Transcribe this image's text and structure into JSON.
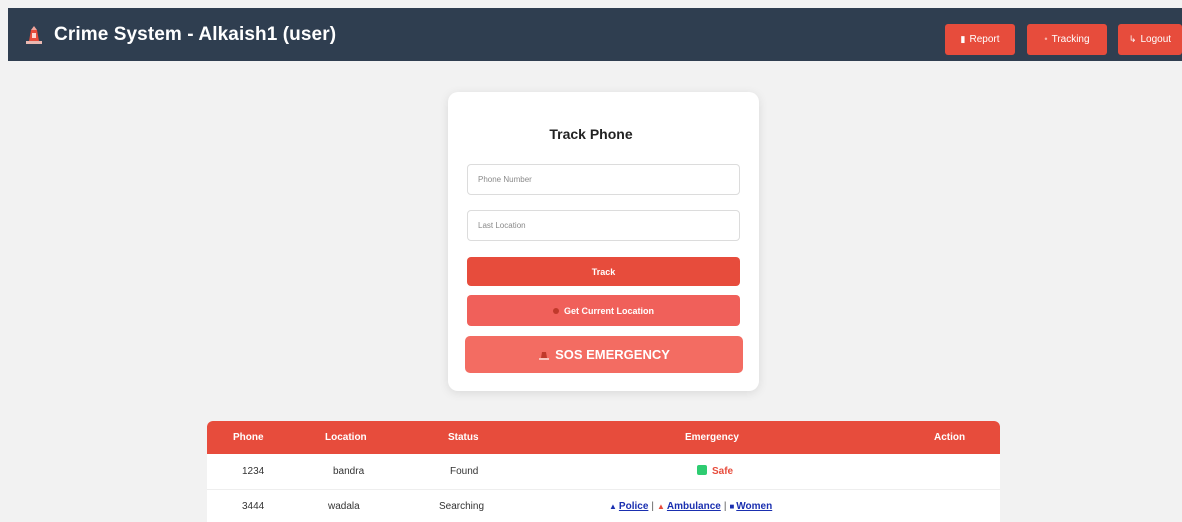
{
  "header": {
    "title": "Crime System - Alkaish1 (user)",
    "buttons": [
      {
        "label": "Report",
        "icon": "document-icon"
      },
      {
        "label": "Tracking",
        "icon": "pin-icon"
      },
      {
        "label": "Logout",
        "icon": "exit-icon"
      }
    ]
  },
  "form": {
    "title": "Track Phone",
    "phone_placeholder": "Phone Number",
    "location_placeholder": "Last Location",
    "track_label": "Track",
    "current_location_label": "Get Current Location",
    "sos_label": "SOS EMERGENCY"
  },
  "table": {
    "headers": [
      "Phone",
      "Location",
      "Status",
      "Emergency",
      "Action"
    ],
    "rows": [
      {
        "phone": "1234",
        "location": "bandra",
        "status": "Found",
        "emergency": {
          "type": "safe",
          "label": "Safe"
        }
      },
      {
        "phone": "3444",
        "location": "wadala",
        "status": "Searching",
        "emergency": {
          "type": "links",
          "links": [
            "Police",
            "Ambulance",
            "Women"
          ]
        }
      }
    ]
  },
  "colors": {
    "header_bg": "#2f3e50",
    "accent": "#e74c3c",
    "link": "#1a2fb0",
    "safe": "#2ecc71"
  }
}
